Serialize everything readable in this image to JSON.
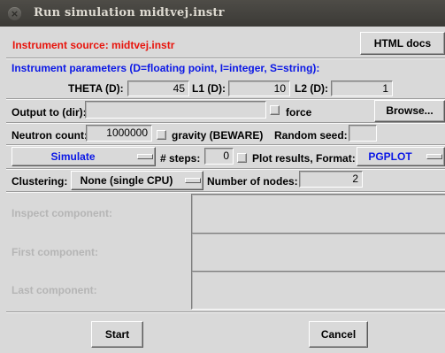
{
  "window": {
    "title": "Run simulation midtvej.instr",
    "close_glyph": "×"
  },
  "source": {
    "label": "Instrument source: midtvej.instr",
    "html_docs_label": "HTML docs"
  },
  "params": {
    "header": "Instrument parameters (D=floating point, I=integer, S=string):",
    "theta": {
      "label": "THETA (D):",
      "value": "45"
    },
    "l1": {
      "label": "L1 (D):",
      "value": "10"
    },
    "l2": {
      "label": "L2 (D):",
      "value": "1"
    }
  },
  "output": {
    "label": "Output to (dir):",
    "value": "",
    "force_label": "force",
    "browse_label": "Browse..."
  },
  "neutron": {
    "label": "Neutron count:",
    "value": "1000000",
    "gravity_label": "gravity (BEWARE)",
    "seed_label": "Random seed:",
    "seed_value": ""
  },
  "run": {
    "mode_selected": "Simulate",
    "steps_label": "# steps:",
    "steps_value": "0",
    "plot_label": "Plot results, Format:",
    "format_selected": "PGPLOT"
  },
  "cluster": {
    "label": "Clustering:",
    "selected": "None (single CPU)",
    "nodes_label": "Number of nodes:",
    "nodes_value": "2"
  },
  "components": {
    "inspect_label": "Inspect component:",
    "first_label": "First component:",
    "last_label": "Last component:"
  },
  "footer": {
    "start_label": "Start",
    "cancel_label": "Cancel"
  },
  "colors": {
    "red_label": "#e8140c",
    "blue_label": "#0a17e6",
    "background": "#d9d9d9",
    "title_bar": "#3c3b37"
  }
}
